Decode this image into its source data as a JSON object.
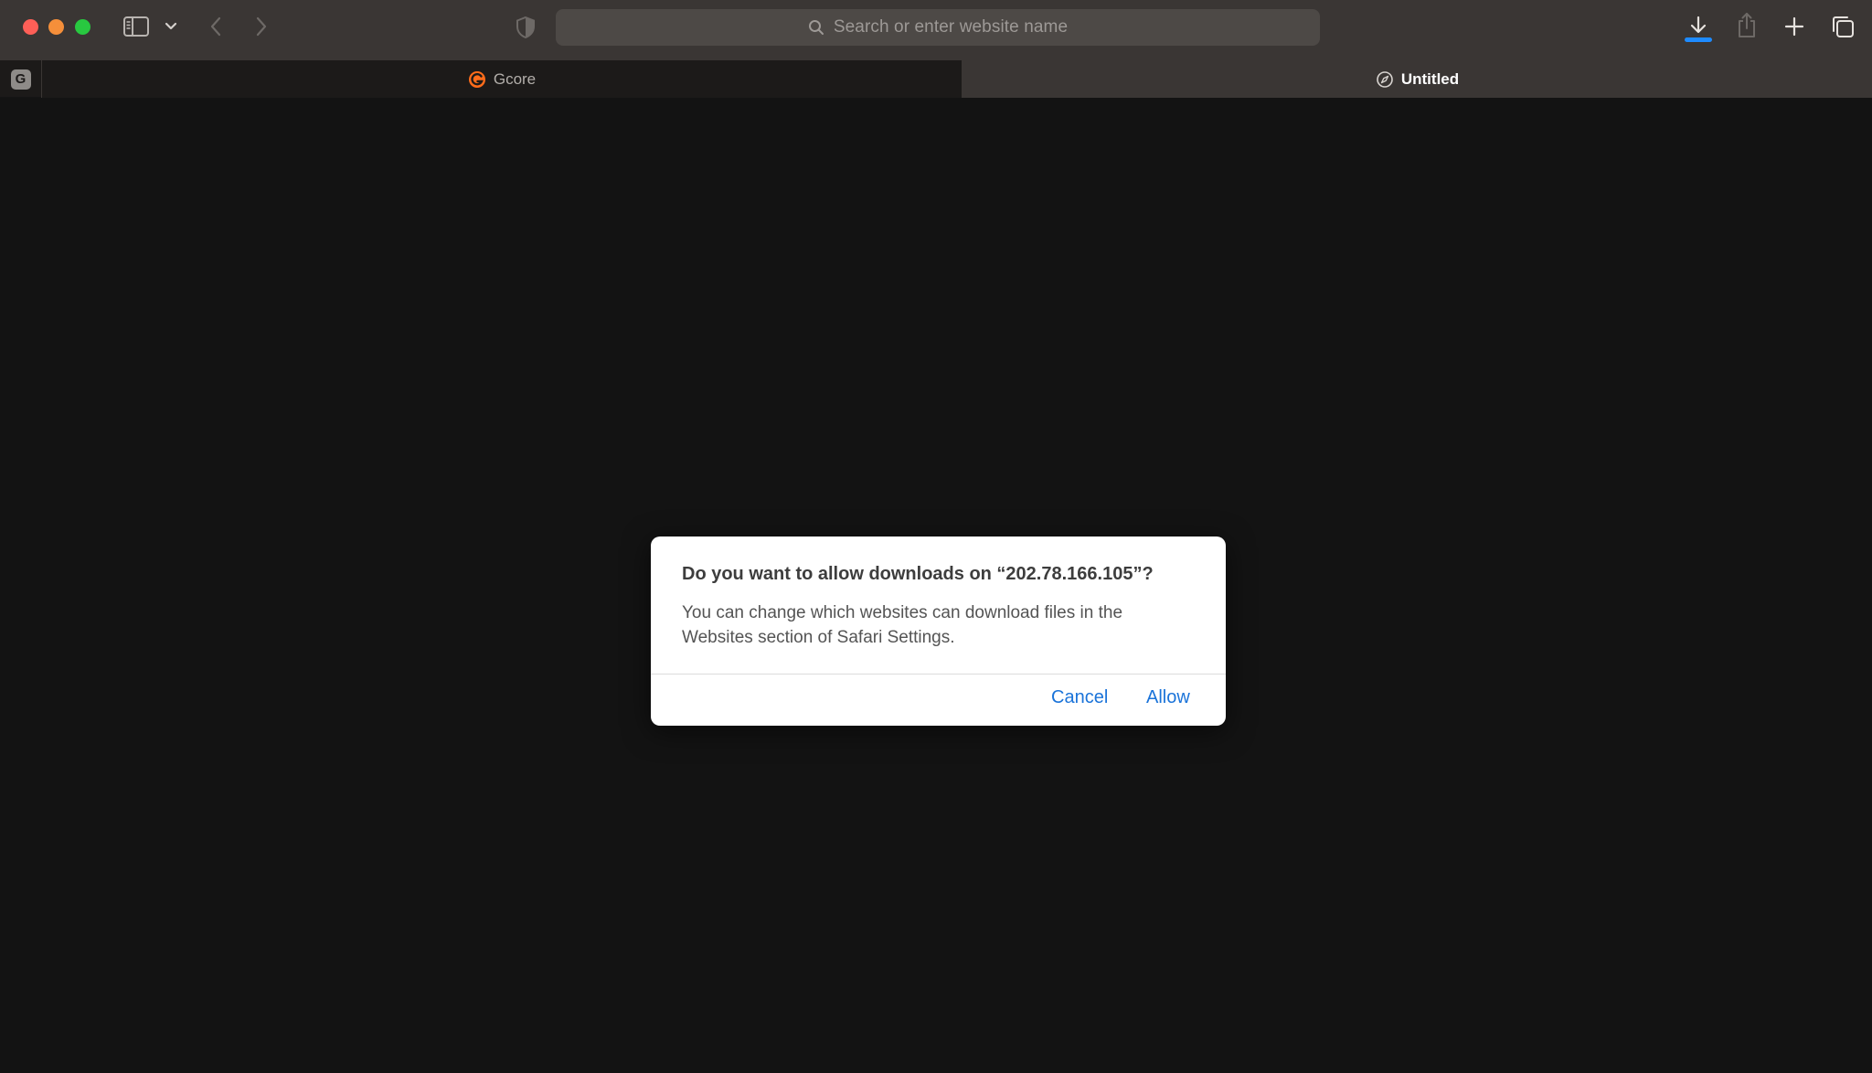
{
  "browser": {
    "address_bar": {
      "placeholder": "Search or enter website name"
    },
    "tabs": [
      {
        "label": "Gcore",
        "active": false
      },
      {
        "label": "Untitled",
        "active": true
      }
    ],
    "pinned_tab": {
      "badge": "G"
    },
    "icons": {
      "sidebar": "sidebar-icon",
      "chevron": "chevron-down-icon",
      "back": "chevron-left-icon",
      "forward": "chevron-right-icon",
      "privacy": "shield-icon",
      "search": "search-icon",
      "download": "download-icon",
      "share": "share-icon",
      "new_tab": "plus-icon",
      "tab_overview": "tab-overview-icon",
      "gcore_favicon": "gcore-favicon-icon",
      "compass": "compass-icon"
    },
    "colors": {
      "toolbar": "#3a3634",
      "traffic_close": "#fe5f57",
      "traffic_minimize": "#febc2e",
      "traffic_maximize": "#28c840",
      "download_progress": "#1e8bff",
      "gcore_orange": "#ff6c1a",
      "link_blue": "#1a73d9"
    },
    "download_progress": 1.0
  },
  "dialog": {
    "title": "Do you want to allow downloads on “202.78.166.105”?",
    "body": "You can change which websites can download files in the Websites section of Safari Settings.",
    "cancel_label": "Cancel",
    "allow_label": "Allow"
  }
}
